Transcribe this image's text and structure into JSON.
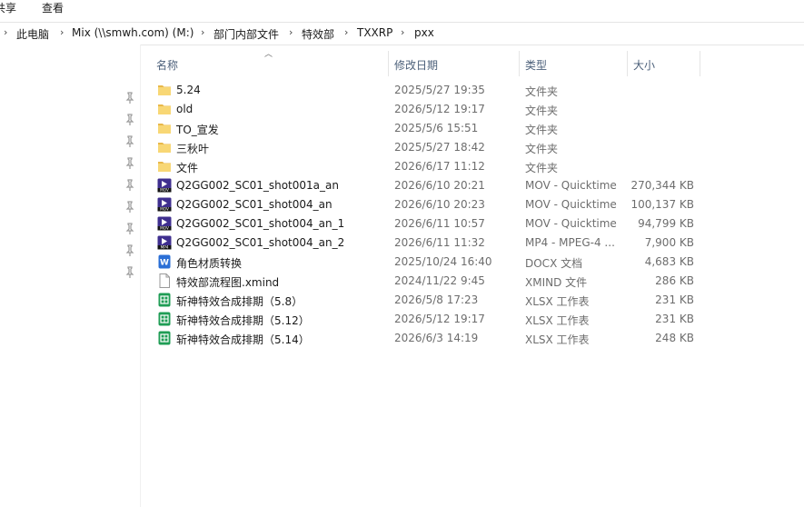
{
  "ribbon": {
    "tab_share": "共享",
    "tab_view": "查看"
  },
  "breadcrumb": [
    "此电脑",
    "Mix (\\\\smwh.com) (M:)",
    "部门内部文件",
    "特效部",
    "TXXRP",
    "pxx"
  ],
  "columns": {
    "name": "名称",
    "date": "修改日期",
    "type": "类型",
    "size": "大小"
  },
  "files": [
    {
      "name": "5.24",
      "date": "2025/5/27 19:35",
      "type": "文件夹",
      "size": "",
      "icon": "folder-icon"
    },
    {
      "name": "old",
      "date": "2026/5/12 19:17",
      "type": "文件夹",
      "size": "",
      "icon": "folder-icon"
    },
    {
      "name": "TO_宣发",
      "date": "2025/5/6 15:51",
      "type": "文件夹",
      "size": "",
      "icon": "folder-icon"
    },
    {
      "name": "三秋叶",
      "date": "2025/5/27 18:42",
      "type": "文件夹",
      "size": "",
      "icon": "folder-icon"
    },
    {
      "name": "文件",
      "date": "2026/6/17 11:12",
      "type": "文件夹",
      "size": "",
      "icon": "folder-icon"
    },
    {
      "name": "Q2GG002_SC01_shot001a_an",
      "date": "2026/6/10 20:21",
      "type": "MOV - Quicktime",
      "size": "270,344 KB",
      "icon": "mov-icon"
    },
    {
      "name": "Q2GG002_SC01_shot004_an",
      "date": "2026/6/10 20:23",
      "type": "MOV - Quicktime",
      "size": "100,137 KB",
      "icon": "mov-icon"
    },
    {
      "name": "Q2GG002_SC01_shot004_an_1",
      "date": "2026/6/11 10:57",
      "type": "MOV - Quicktime",
      "size": "94,799 KB",
      "icon": "mov-icon"
    },
    {
      "name": "Q2GG002_SC01_shot004_an_2",
      "date": "2026/6/11 11:32",
      "type": "MP4 - MPEG-4 ...",
      "size": "7,900 KB",
      "icon": "mp4-icon"
    },
    {
      "name": "角色材质转换",
      "date": "2025/10/24 16:40",
      "type": "DOCX 文档",
      "size": "4,683 KB",
      "icon": "docx-icon"
    },
    {
      "name": "特效部流程图.xmind",
      "date": "2024/11/22 9:45",
      "type": "XMIND 文件",
      "size": "286 KB",
      "icon": "file-icon"
    },
    {
      "name": "斩神特效合成排期（5.8）",
      "date": "2026/5/8 17:23",
      "type": "XLSX 工作表",
      "size": "231 KB",
      "icon": "xlsx-icon"
    },
    {
      "name": "斩神特效合成排期（5.12）",
      "date": "2026/5/12 19:17",
      "type": "XLSX 工作表",
      "size": "231 KB",
      "icon": "xlsx-icon"
    },
    {
      "name": "斩神特效合成排期（5.14）",
      "date": "2026/6/3 14:19",
      "type": "XLSX 工作表",
      "size": "248 KB",
      "icon": "xlsx-icon"
    }
  ],
  "colors": {
    "header_text": "#4c607a",
    "folder": "#f8d775",
    "video": "#3f2f8f",
    "xlsx": "#1f9d55",
    "docx": "#2b6fd6"
  }
}
